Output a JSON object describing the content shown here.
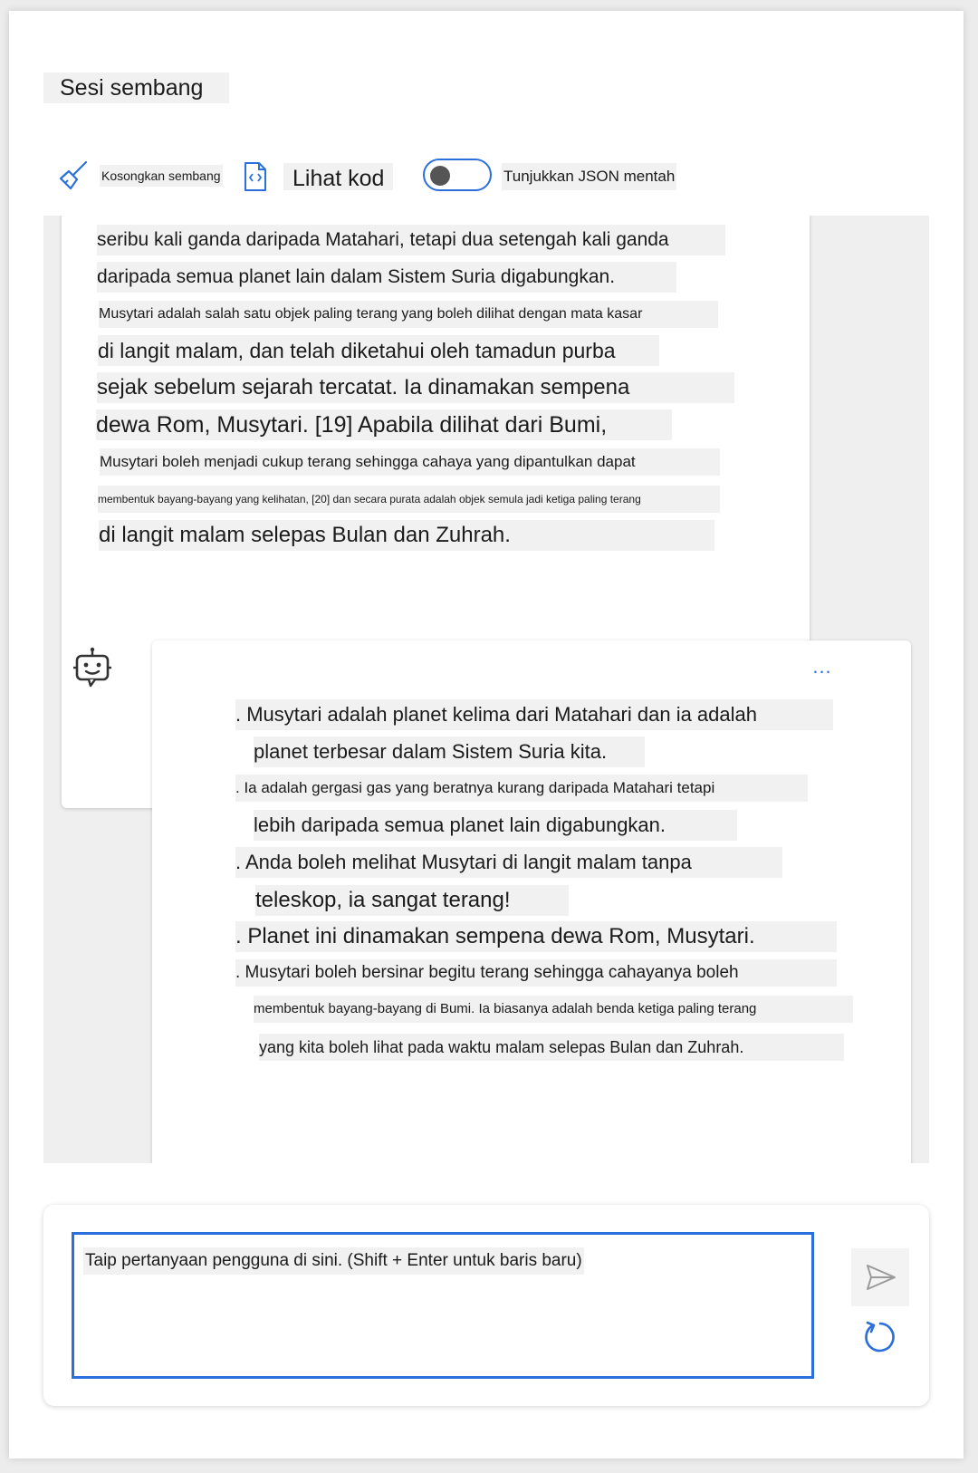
{
  "session": {
    "title": "Sesi sembang"
  },
  "toolbar": {
    "clear_label": "Kosongkan sembang",
    "code_label": "Lihat kod",
    "json_label": "Tunjukkan JSON mentah"
  },
  "user_message": {
    "lines": [
      "seribu kali ganda daripada Matahari, tetapi dua setengah kali ganda",
      "daripada semua planet lain dalam Sistem Suria digabungkan.",
      "Musytari adalah salah satu objek paling terang yang boleh dilihat dengan mata kasar",
      "di langit malam, dan telah diketahui oleh tamadun purba",
      "sejak sebelum sejarah tercatat. Ia dinamakan sempena",
      "dewa Rom, Musytari. [19] Apabila dilihat dari Bumi,",
      "Musytari boleh menjadi cukup terang sehingga cahaya yang dipantulkan dapat",
      "membentuk bayang-bayang yang kelihatan, [20] dan secara purata adalah objek semula jadi ketiga paling terang",
      "di langit malam selepas Bulan dan Zuhrah."
    ]
  },
  "bot_message": {
    "more_label": "...",
    "lines": [
      ". Musytari adalah planet kelima dari Matahari dan ia adalah",
      "planet terbesar dalam Sistem Suria kita.",
      ". Ia adalah gergasi gas yang beratnya kurang daripada Matahari tetapi",
      "lebih daripada semua planet lain digabungkan.",
      ". Anda boleh melihat Musytari di langit malam tanpa",
      "teleskop, ia sangat terang!",
      ". Planet ini dinamakan sempena dewa Rom, Musytari.",
      ". Musytari boleh bersinar begitu terang sehingga cahayanya boleh",
      "membentuk bayang-bayang di Bumi. Ia biasanya adalah benda ketiga paling terang",
      "yang kita boleh lihat pada waktu malam selepas Bulan dan Zuhrah."
    ]
  },
  "input": {
    "placeholder": "Taip pertanyaan pengguna di sini. (Shift + Enter untuk baris baru)"
  },
  "icons": {
    "clear": "broom-icon",
    "code": "code-file-icon",
    "bot": "bot-avatar-icon",
    "send": "send-icon",
    "reset": "refresh-icon"
  },
  "colors": {
    "accent": "#2a6fdb",
    "highlight": "#f1f1f1"
  }
}
